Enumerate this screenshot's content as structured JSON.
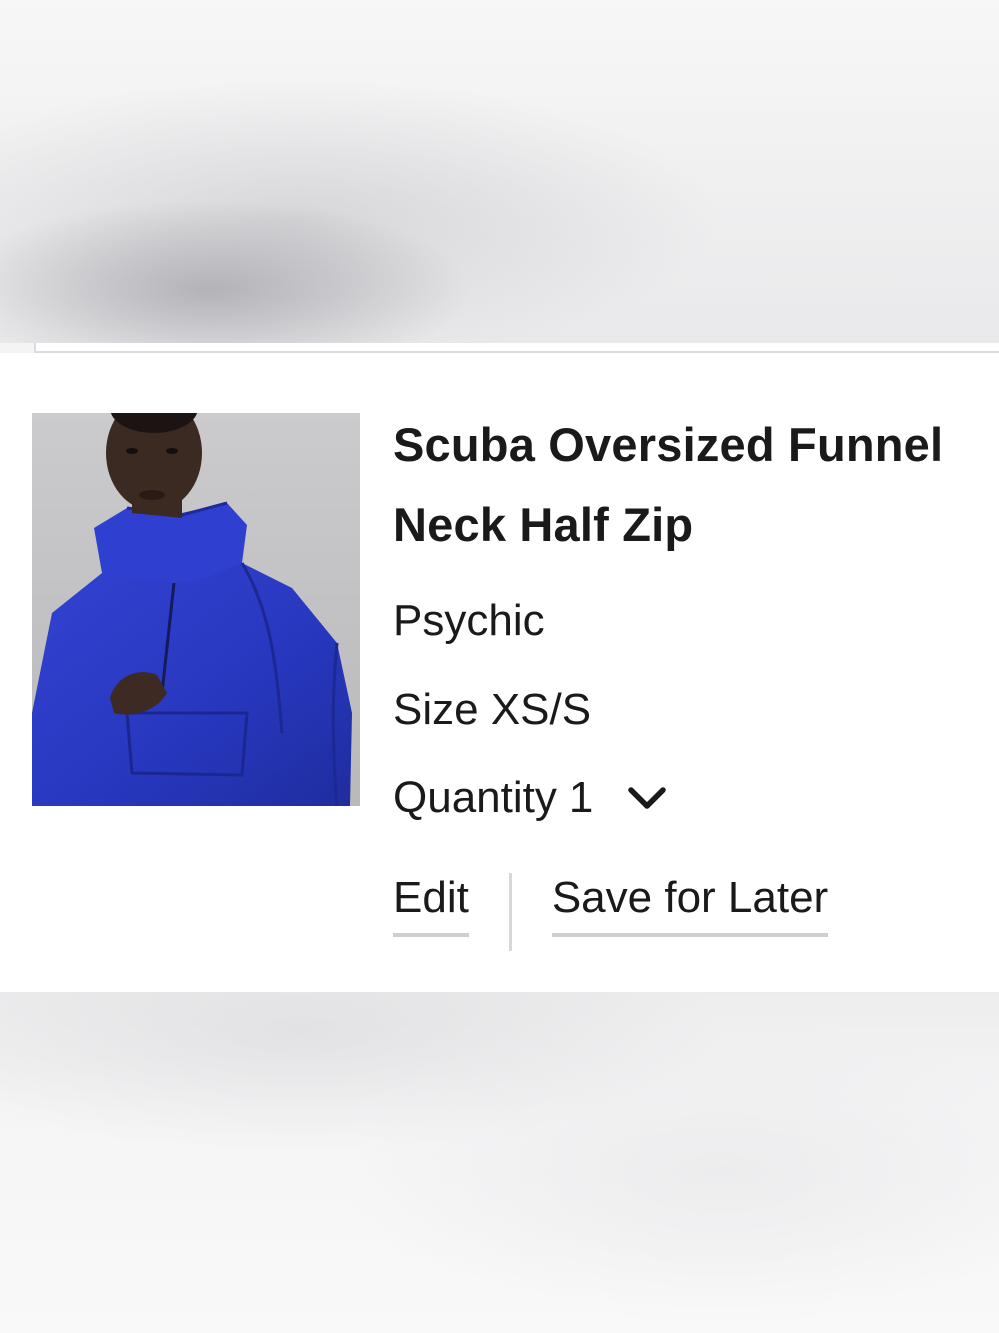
{
  "cart_item": {
    "title": "Scuba Oversized Funnel Neck Half Zip",
    "color": "Psychic",
    "size_label": "Size",
    "size_value": "XS/S",
    "quantity_label": "Quantity",
    "quantity_value": "1",
    "actions": {
      "edit_label": "Edit",
      "save_for_later_label": "Save for Later"
    },
    "colors": {
      "product_blue": "#2b3bc4",
      "link_underline": "#cfcfd1"
    }
  }
}
